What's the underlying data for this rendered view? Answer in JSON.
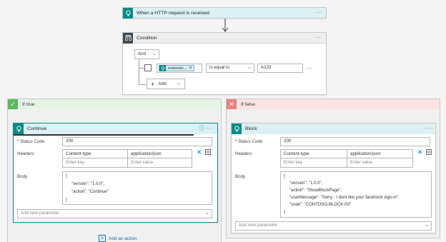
{
  "trigger": {
    "title": "When a HTTP request is received",
    "more": "···"
  },
  "condition": {
    "title": "Condition",
    "more": "···",
    "and_label": "And",
    "token_label": "extensio...",
    "token_remove": "×",
    "operator": "is equal to",
    "value": "A123",
    "row_more": "···",
    "add_label": "Add"
  },
  "if_true": {
    "title": "If true",
    "action": {
      "title": "Continue",
      "info": "ⓘ",
      "more": "···",
      "status_label": "* Status Code",
      "status_value": "200",
      "headers_label": "Headers",
      "header_key": "Content-type",
      "header_value": "application/json",
      "key_placeholder": "Enter key",
      "value_placeholder": "Enter value",
      "body_label": "Body",
      "body_lines": [
        "{",
        "\"version\": \"1.0.0\",",
        "\"action\": \"Continue\"",
        "}"
      ],
      "add_param": "Add new parameter"
    },
    "add_action": "Add an action"
  },
  "if_false": {
    "title": "If false",
    "action": {
      "title": "Block",
      "more": "···",
      "status_label": "* Status Code",
      "status_value": "200",
      "headers_label": "Headers",
      "header_key": "Content-type",
      "header_value": "application/json",
      "key_placeholder": "Enter key",
      "value_placeholder": "Enter value",
      "body_label": "Body",
      "body_lines": [
        "{",
        "\"version\": \"1.0.0\",",
        "\"action\": \"ShowBlockPage\",",
        "\"userMessage\": \"Sorry - I dont like your facebook sign-in\",",
        "\"code\": \"CONTOSO-BLOCK-00\"",
        "}"
      ],
      "add_param": "Add new parameter"
    }
  },
  "colors": {
    "teal": "#0b8a8a",
    "true_green": "#5cb85c",
    "false_red": "#e88080",
    "header_teal_bg": "#dcf1f3",
    "true_bg": "#e6f4e6",
    "false_bg": "#fbe3e3"
  },
  "icons": {
    "trigger": "http-request-icon",
    "condition": "condition-icon",
    "response": "response-icon",
    "check": "check-icon",
    "close": "close-icon"
  }
}
